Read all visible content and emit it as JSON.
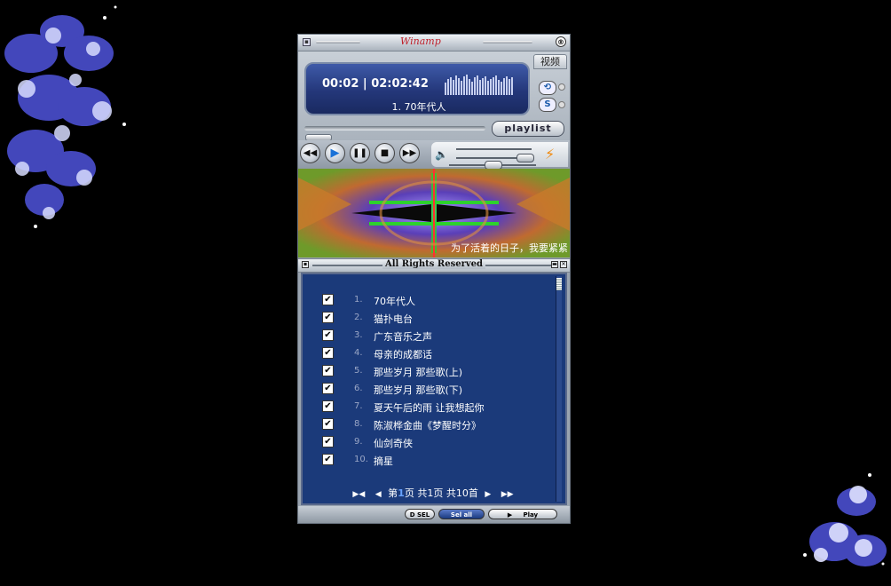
{
  "player": {
    "logo": "Winamp",
    "video_tab": "视频",
    "time_current": "00:02",
    "time_total": "02:02:42",
    "now_playing": "1. 70年代人",
    "playlist_button": "playlist",
    "side_button_s": "S",
    "lyric": "为了活着的日子，我要紧紧"
  },
  "playlist": {
    "title": "All Rights Reserved",
    "tracks": [
      {
        "num": "1.",
        "name": "70年代人",
        "checked": true
      },
      {
        "num": "2.",
        "name": "猫扑电台",
        "checked": true
      },
      {
        "num": "3.",
        "name": "广东音乐之声",
        "checked": true
      },
      {
        "num": "4.",
        "name": "母亲的成都话",
        "checked": true
      },
      {
        "num": "5.",
        "name": "那些岁月 那些歌(上)",
        "checked": true
      },
      {
        "num": "6.",
        "name": "那些岁月 那些歌(下)",
        "checked": true
      },
      {
        "num": "7.",
        "name": "夏天午后的雨 让我想起你",
        "checked": true
      },
      {
        "num": "8.",
        "name": "陈淑桦金曲《梦醒时分》",
        "checked": true
      },
      {
        "num": "9.",
        "name": "仙剑奇侠",
        "checked": true
      },
      {
        "num": "10.",
        "name": "摘星",
        "checked": true
      }
    ],
    "pager": {
      "page_prefix": "第",
      "page_current": "1",
      "page_suffix": "页",
      "total_pages": "共1页",
      "total_tracks": "共10首"
    }
  },
  "bottom_bar": {
    "desel_label": "D SEL",
    "sel_all_label": "Sel all",
    "play_label": "Play"
  },
  "colors": {
    "lcd_bg": "#24377a",
    "playlist_bg": "#1b3a7a",
    "accent_play": "#1a72d8"
  }
}
